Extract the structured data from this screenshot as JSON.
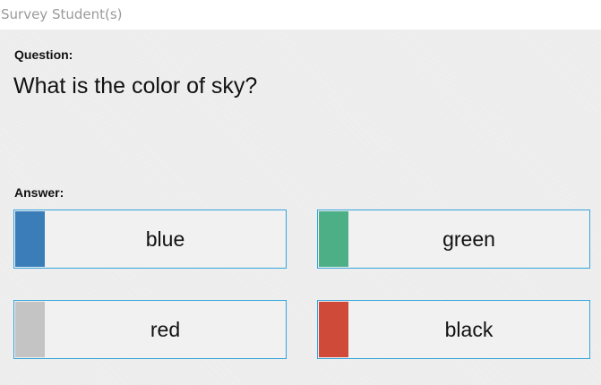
{
  "window": {
    "title": "Survey Student(s)"
  },
  "question": {
    "label": "Question:",
    "text": "What is the color of sky?"
  },
  "answer": {
    "label": "Answer:",
    "options": [
      {
        "label": "blue",
        "swatch_color": "#3a7db8"
      },
      {
        "label": "green",
        "swatch_color": "#4daf86"
      },
      {
        "label": "red",
        "swatch_color": "#c4c4c4"
      },
      {
        "label": "black",
        "swatch_color": "#cf4a38"
      }
    ]
  },
  "colors": {
    "option_border": "#35a3dc",
    "panel_background": "#efefef"
  }
}
